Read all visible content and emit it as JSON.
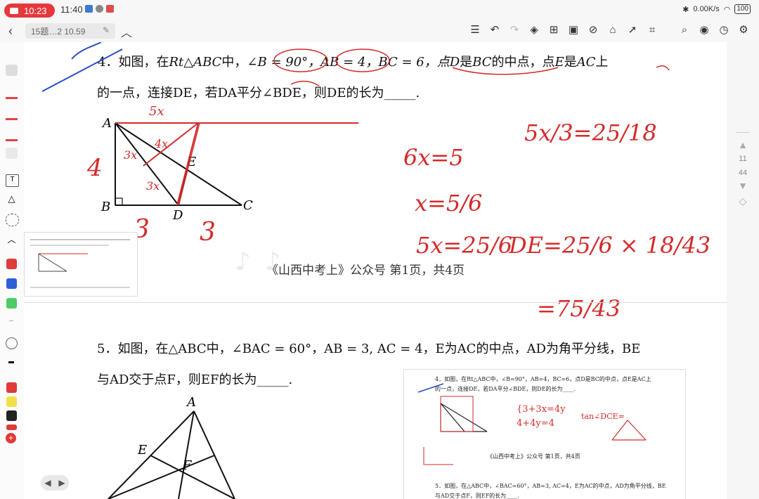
{
  "status_bar": {
    "recording_time": "10:23",
    "clock": "11:40",
    "network_speed": "0.00K/s",
    "battery": "100"
  },
  "toolbar": {
    "doc_title": "15题…2 10.59"
  },
  "page_indicator": {
    "current": "11",
    "total": "44"
  },
  "q4": {
    "line1_num": "4．如图，在",
    "line1_a": "Rt△ABC",
    "line1_b": "中，",
    "line1_c": "∠B = 90°，",
    "line1_d": "AB = 4，",
    "line1_e": "BC = 6，点",
    "line1_f": "D",
    "line1_g": "是",
    "line1_h": "BC",
    "line1_i": "的中点，点",
    "line1_j": "E",
    "line1_k": "是",
    "line1_l": "AC",
    "line1_m": "上",
    "line2": "的一点，连接DE，若DA平分∠BDE，则DE的长为_____.",
    "labels": {
      "A": "A",
      "B": "B",
      "C": "C",
      "D": "D",
      "E": "E"
    }
  },
  "watermark": "《山西中考上》公众号  第1页，共4页",
  "q5": {
    "line1": "5．如图，在△ABC中，∠BAC = 60°，AB = 3, AC = 4，E为AC的中点，AD为角平分线，BE",
    "line2": "与AD交于点F，则EF的长为_____.",
    "labels": {
      "A": "A",
      "E": "E",
      "F": "F"
    }
  },
  "handwriting": {
    "n1": "5x",
    "n2": "4x",
    "n3": "3x",
    "n4": "3x",
    "n5": "4",
    "n6": "3",
    "n7": "3",
    "n8": "6x=5",
    "n9": "x=5/6",
    "n10": "5x=25/6",
    "n11": "5x/3=25/18",
    "n12": "DE=25/6 × 18/43",
    "n13": "=75/43"
  },
  "thumb_big": {
    "line1": "4．如图，在Rt△ABC中，∠B=90°，AB=4，BC=6，点D是BC的中点，点E是AC上",
    "line2": "的一点，连接DE，若DA平分∠BDE，则DE的长为____.",
    "watermark": "《山西中考上》公众号  第1页，共4页",
    "line3": "5．如图，在△ABC中，∠BAC=60°，AB=3, AC=4，E为AC的中点，AD为角平分线，BE",
    "line4": "与AD交于点F，则EF的长为____."
  },
  "colors": {
    "ink_red": "#d42a2a",
    "ink_blue": "#2b4fc4",
    "record_red": "#e5383b"
  }
}
